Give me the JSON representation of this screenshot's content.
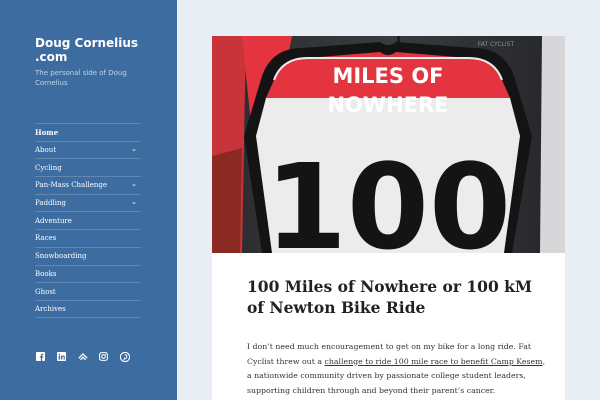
{
  "site": {
    "title": "Doug Cornelius .com",
    "description": "The personal side of Doug Cornelius"
  },
  "nav": {
    "items": [
      {
        "label": "Home",
        "current": true
      },
      {
        "label": "About",
        "has_children": true
      },
      {
        "label": "Cycling"
      },
      {
        "label": "Pan-Mass Challenge",
        "has_children": true
      },
      {
        "label": "Paddling",
        "has_children": true
      },
      {
        "label": "Adventure"
      },
      {
        "label": "Races"
      },
      {
        "label": "Snowboarding"
      },
      {
        "label": "Books"
      },
      {
        "label": "Ghost"
      },
      {
        "label": "Archives"
      }
    ],
    "toggle_glyph": "⌄"
  },
  "social": {
    "icons": [
      "facebook-icon",
      "linkedin-icon",
      "strava-icon",
      "instagram-icon",
      "pinterest-icon"
    ]
  },
  "post": {
    "hero": {
      "sign_line1": "MILES OF",
      "sign_line2": "NOWHERE",
      "sign_number": "100",
      "jersey_brand": "FAT CYCLIST"
    },
    "title": "100 Miles of Nowhere or 100 kM of Newton Bike Ride",
    "body_before_link": "I don’t need much encouragement to get on my bike for a long ride. Fat Cyclist threw out a ",
    "body_link": "challenge to ride 100 mile race to benefit Camp Kesem",
    "body_after_link": ", a nationwide community driven by passionate college student leaders, supporting children through and beyond their parent’s cancer."
  },
  "colors": {
    "sidebar": "#3d6ca0",
    "page_bg": "#e9eef5",
    "jersey_red": "#e3343f",
    "sign_black": "#141414"
  }
}
